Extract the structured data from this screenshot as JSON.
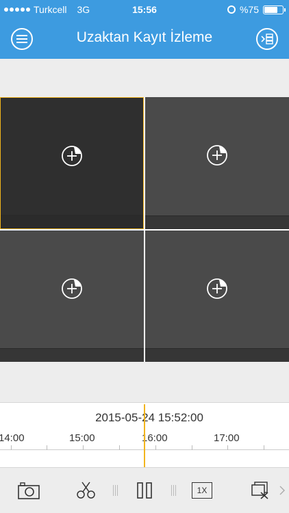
{
  "status_bar": {
    "carrier": "Turkcell",
    "network": "3G",
    "time": "15:56",
    "battery_text": "%75",
    "battery_level": 0.75
  },
  "nav": {
    "title": "Uzaktan Kayıt İzleme",
    "menu_icon": "menu-icon",
    "list_icon": "channel-list-icon"
  },
  "grid": {
    "cells": [
      {
        "selected": true,
        "icon": "add-camera-icon"
      },
      {
        "selected": false,
        "icon": "add-camera-icon"
      },
      {
        "selected": false,
        "icon": "add-camera-icon"
      },
      {
        "selected": false,
        "icon": "add-camera-icon"
      }
    ]
  },
  "timeline": {
    "datetime": "2015-05-24  15:52:00",
    "tick_labels": [
      "14:00",
      "15:00",
      "16:00",
      "17:00"
    ]
  },
  "toolbar": {
    "speed_label": "1X",
    "icons": [
      "camera-icon",
      "scissors-icon",
      "pause-icon",
      "speed-icon",
      "close-all-icon",
      "chevron-right-icon"
    ]
  },
  "colors": {
    "accent": "#3d9be0",
    "selection": "#f1b41c"
  }
}
